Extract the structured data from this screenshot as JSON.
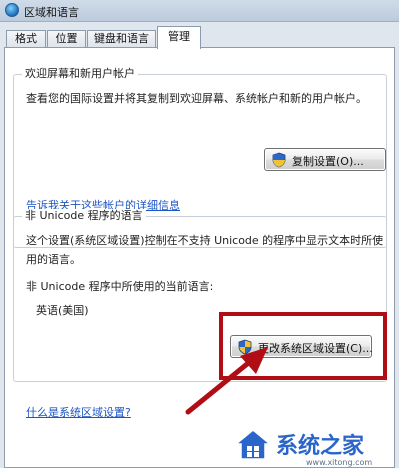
{
  "window": {
    "title": "区域和语言"
  },
  "tabs": [
    {
      "label": "格式"
    },
    {
      "label": "位置"
    },
    {
      "label": "键盘和语言"
    },
    {
      "label": "管理",
      "active": true
    }
  ],
  "welcome_group": {
    "legend": "欢迎屏幕和新用户帐户",
    "description": "查看您的国际设置并将其复制到欢迎屏幕、系统帐户和新的用户帐户。",
    "copy_button_label": "复制设置(O)...",
    "info_link": "告诉我关于这些帐户的详细信息"
  },
  "unicode_group": {
    "legend": "非 Unicode 程序的语言",
    "description_line1": "这个设置(系统区域设置)控制在不支持 Unicode 的程序中显示文本时所使",
    "description_line2": "用的语言。",
    "current_language_label": "非 Unicode 程序中所使用的当前语言:",
    "current_language_value": "英语(美国)",
    "change_button_label": "更改系统区域设置(C)...",
    "what_is_link": "什么是系统区域设置?"
  },
  "watermark": {
    "text": "系统之家",
    "url": "www.xitong.com"
  },
  "colors": {
    "highlight": "#b00d14",
    "link": "#1c55c4",
    "watermark": "#2a66c9"
  }
}
